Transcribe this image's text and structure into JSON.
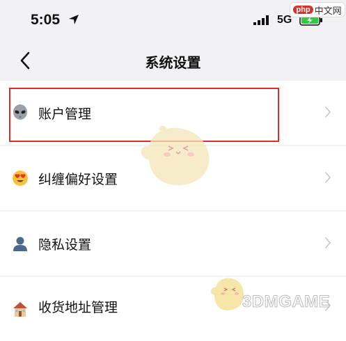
{
  "status_bar": {
    "time": "5:05",
    "network": "5G",
    "accent": "#2ecc40"
  },
  "watermarks": {
    "php_badge": "php",
    "php_text": "中文网",
    "game_site": "3DMGAME"
  },
  "header": {
    "title": "系统设置"
  },
  "settings": {
    "items": [
      {
        "label": "账户管理",
        "icon": "alien-icon"
      },
      {
        "label": "纠缠偏好设置",
        "icon": "heart-eyes-icon"
      },
      {
        "label": "隐私设置",
        "icon": "person-silhouette-icon"
      },
      {
        "label": "收货地址管理",
        "icon": "house-icon"
      }
    ]
  },
  "colors": {
    "highlight": "#e02b2b",
    "background": "#f2f2f4",
    "chevron": "#c4c4c8"
  }
}
